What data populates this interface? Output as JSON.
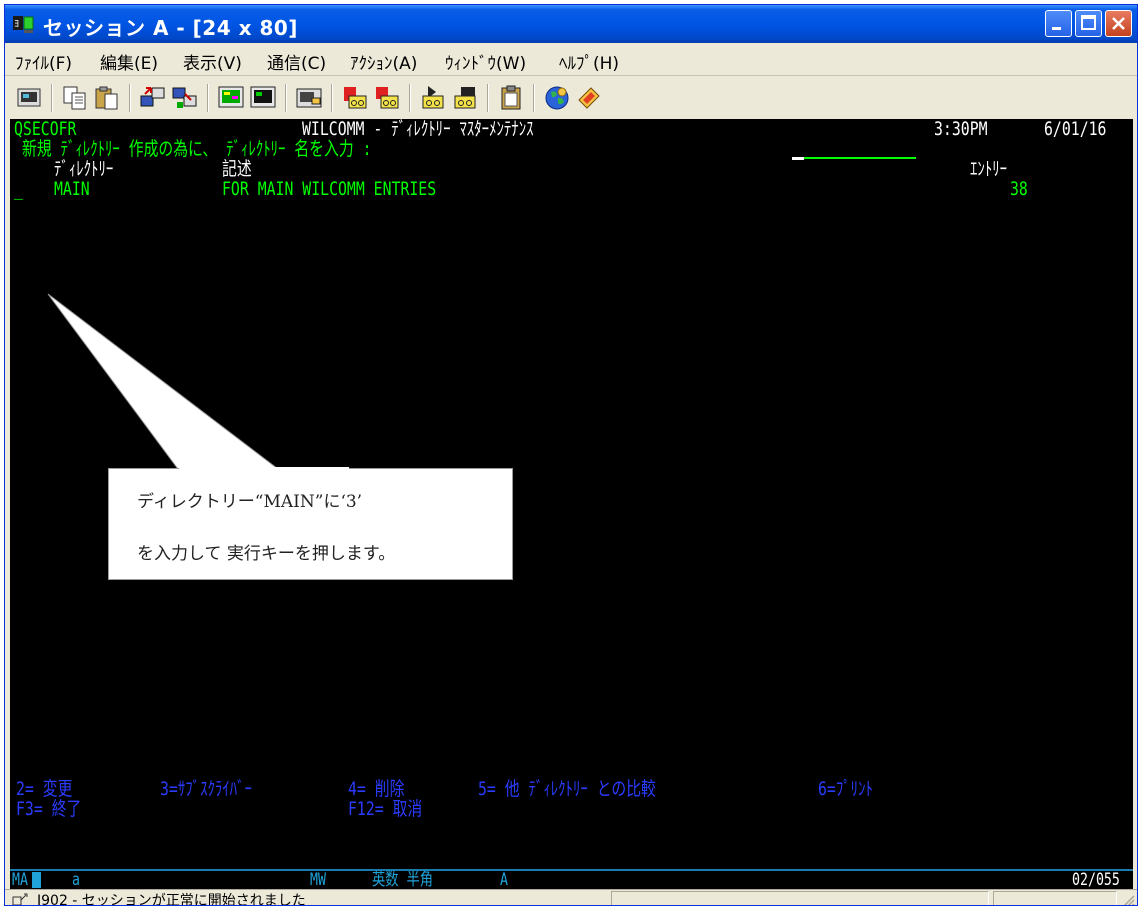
{
  "window": {
    "title": "セッション A - [24 x 80]"
  },
  "menu": [
    "ﾌｧｲﾙ(F)",
    "編集(E)",
    "表示(V)",
    "通信(C)",
    "ｱｸｼｮﾝ(A)",
    "ｳｨﾝﾄﾞｳ(W)",
    "ﾍﾙﾌﾟ(H)"
  ],
  "toolbar": {
    "icons": [
      "display-icon",
      "copy-icon",
      "paste-icon",
      "send-file-icon",
      "receive-file-icon",
      "display-setup-icon",
      "display-color-icon",
      "keyboard-map-icon",
      "record-macro-icon",
      "stop-macro-icon",
      "play-macro-icon",
      "macro-setup-icon",
      "clipboard-icon",
      "globe-icon",
      "help-icon"
    ]
  },
  "terminal": {
    "user": "QSECOFR",
    "screen_title": "WILCOMM - ﾃﾞｨﾚｸﾄﾘｰ ﾏｽﾀｰﾒﾝﾃﾅﾝｽ",
    "time": "3:30PM",
    "date": "6/01/16",
    "prompt": "新規 ﾃﾞｨﾚｸﾄﾘｰ 作成の為に、 ﾃﾞｨﾚｸﾄﾘｰ 名を入力 :",
    "columns": {
      "directory": "ﾃﾞｨﾚｸﾄﾘｰ",
      "description": "記述",
      "entries": "ｴﾝﾄﾘｰ"
    },
    "rows": [
      {
        "option": "_",
        "directory": "MAIN",
        "description": "FOR MAIN WILCOMM ENTRIES",
        "entries": "38"
      }
    ],
    "options_line1": [
      "2= 変更",
      "3=ｻﾌﾞｽｸﾗｲﾊﾞｰ",
      "4= 削除",
      "5= 他 ﾃﾞｨﾚｸﾄﾘｰ との比較",
      "6=ﾌﾟﾘﾝﾄ"
    ],
    "options_line2": [
      "F3= 終了",
      "F12= 取消"
    ]
  },
  "oia": {
    "mode": "MA",
    "field1": "a",
    "mw": "MW",
    "input_mode": "英数 半角",
    "field2": "A",
    "cursor_position": "02/055"
  },
  "status": {
    "message": "I902 - セッションが正常に開始されました"
  },
  "callout": {
    "line1": "ディレクトリー“MAIN”に‘3’",
    "line2": "を入力して 実行キーを押します。"
  }
}
